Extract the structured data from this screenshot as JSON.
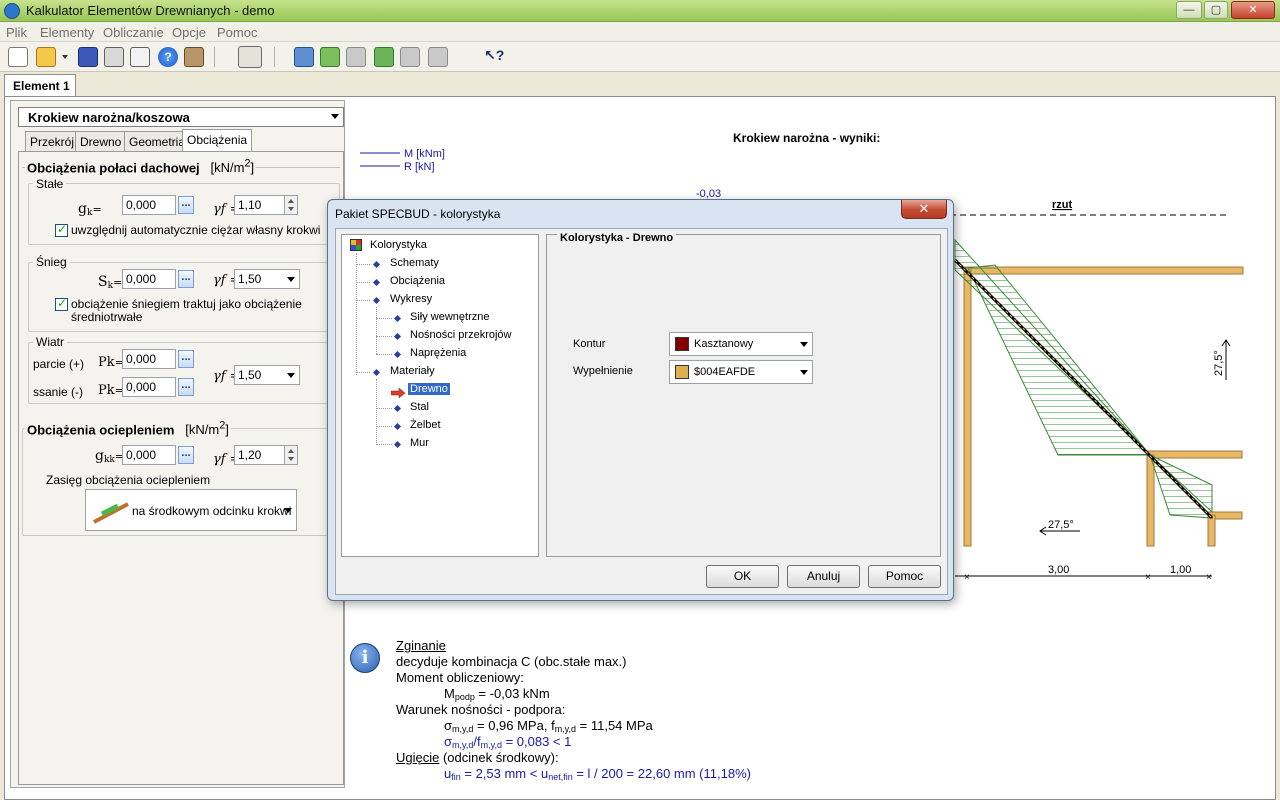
{
  "window": {
    "title": "Kalkulator Elementów Drewnianych - demo",
    "minimize": "—",
    "maximize": "▢",
    "close": "✕"
  },
  "menu": [
    "Plik",
    "Elementy",
    "Obliczanie",
    "Opcje",
    "Pomoc"
  ],
  "toolbar_icons": [
    "new-icon",
    "open-icon",
    "save-icon",
    "print-icon",
    "print-preview-icon",
    "help-icon",
    "exit-icon",
    "calculator-icon",
    "window-icon",
    "add-element-icon",
    "delete-element-icon",
    "import-icon",
    "export-icon",
    "export2-icon",
    "context-help-icon"
  ],
  "element_tab": "Element 1",
  "left": {
    "element_type": "Krokiew narożna/koszowa",
    "tabs": [
      "Przekrój",
      "Drewno",
      "Geometria",
      "Obciążenia"
    ],
    "active_tab": "Obciążenia",
    "roof_loads": {
      "title": "Obciążenia połaci dachowej",
      "unit": "[kN/m",
      "unit_sup": "2",
      "unit_end": "]",
      "stale": {
        "label": "Stałe",
        "gk_label": "g",
        "gk_sub": "k",
        "gk_value": "0,000",
        "gamma_label": "γf =",
        "gamma_value": "1,10",
        "checkbox_label": "uwzględnij automatycznie ciężar  własny krokwi"
      },
      "snieg": {
        "label": "Śnieg",
        "sk_label": "S",
        "sk_sub": "k",
        "sk_value": "0,000",
        "gamma_label": "γf =",
        "gamma_value": "1,50",
        "checkbox_line1": "obciążenie śniegiem traktuj jako obciążenie",
        "checkbox_line2": "średniotrwałe"
      },
      "wiatr": {
        "label": "Wiatr",
        "parcie_label": "parcie (+)",
        "ssanie_label": "ssanie (-)",
        "pk_label": "Pk",
        "parcie_value": "0,000",
        "ssanie_value": "0,000",
        "gamma_label": "γf =",
        "gamma_value": "1,50"
      }
    },
    "insulation": {
      "title": "Obciążenia ociepleniem",
      "unit": "[kN/m",
      "unit_sup": "2",
      "unit_end": "]",
      "gkk_label": "g",
      "gkk_sub": "kk",
      "gkk_value": "0,000",
      "gamma_label": "γf =",
      "gamma_value": "1,20",
      "range_label": "Zasięg obciążenia ociepleniem",
      "range_value": "na środkowym odcinku krokwi"
    },
    "eq": "="
  },
  "diagram": {
    "results_title": "Krokiew narożna - wyniki:",
    "legend_m": "M [kNm]",
    "legend_r": "R [kN]",
    "top_value": "-0,03",
    "rzut_label": "rzut",
    "angle_right": "27,5°",
    "angle_bottom": "27,5°",
    "dim_1": "3,00",
    "dim_2": "1,00",
    "colors": {
      "hatch": "#3a8a3a",
      "hatch_fill": "#e8f3e4",
      "timber": "#e8b866",
      "timber_border": "#a07a38",
      "legend_line": "#1a1aa8"
    }
  },
  "info": {
    "title": "Zginanie",
    "line1": "decyduje kombinacja C (obc.stałe max.)",
    "line2": "Moment obliczeniowy:",
    "m_label": "M",
    "m_sub": "podp",
    "m_value": " = -0,03 kNm",
    "line3": "Warunek nośności - podpora:",
    "sigma_label": "σ",
    "sigma_sub": "m,y,d",
    "sigma_value": " = 0,96 MPa,  ",
    "f_label": "f",
    "f_sub": "m,y,d",
    "f_value": " = 11,54 MPa",
    "ratio_sigma": "σ",
    "ratio_sigma_sub": "m,y,d",
    "ratio_f": "/f",
    "ratio_f_sub": "m,y,d",
    "ratio_value": " = 0,083  <  1",
    "ugiecie": "Ugięcie",
    "ugiecie_rest": " (odcinek środkowy):",
    "u_label": "u",
    "u_sub": "fin",
    "u_value": " = 2,53 mm  <   ",
    "unet_label": "u",
    "unet_sub": "net,fin",
    "unet_value": " = l / 200 = 22,60 mm      (11,18%)"
  },
  "dialog": {
    "title": "Pakiet SPECBUD - kolorystyka",
    "close": "✕",
    "tree": {
      "root": "Kolorystyka",
      "schematy": "Schematy",
      "obciazenia": "Obciążenia",
      "wykresy": "Wykresy",
      "sily": "Siły wewnętrzne",
      "nosnosci": "Nośności przekrojów",
      "naprezenia": "Naprężenia",
      "materialy": "Materiały",
      "drewno": "Drewno",
      "stal": "Stal",
      "zelbet": "Żelbet",
      "mur": "Mur"
    },
    "panel_title": "Kolorystyka - Drewno",
    "kontur_label": "Kontur",
    "kontur_value": "Kasztanowy",
    "kontur_color": "#800000",
    "wypelnienie_label": "Wypełnienie",
    "wypelnienie_value": "$004EAFDE",
    "wypelnienie_color": "#deaf4e",
    "ok": "OK",
    "cancel": "Anuluj",
    "help": "Pomoc"
  }
}
